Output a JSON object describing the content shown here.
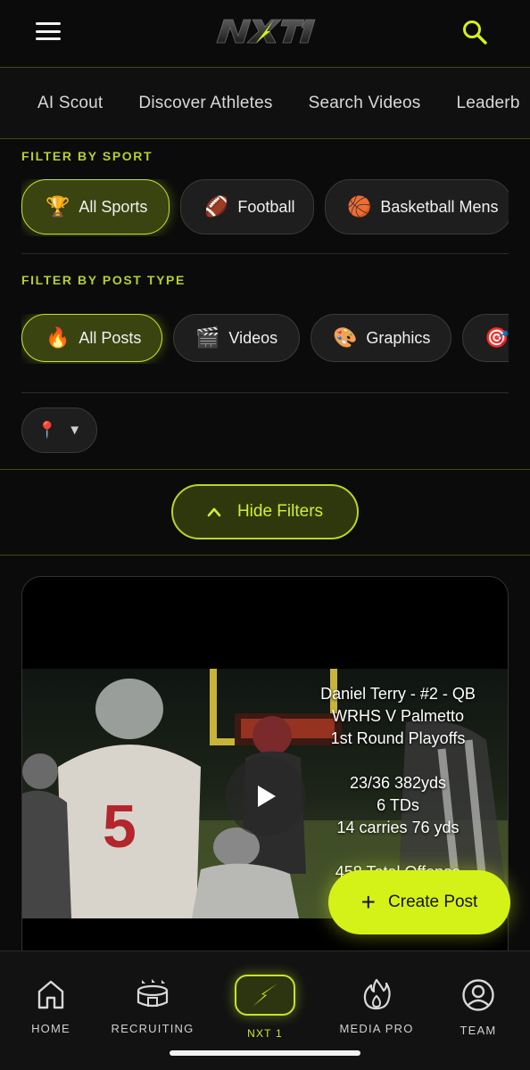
{
  "header": {
    "logo_text": "NXT1",
    "menu_icon": "hamburger-menu-icon",
    "search_icon": "search-icon"
  },
  "tabs": [
    {
      "label": "AI Scout"
    },
    {
      "label": "Discover Athletes"
    },
    {
      "label": "Search Videos"
    },
    {
      "label": "Leaderb"
    }
  ],
  "sport_filter": {
    "label": "FILTER BY SPORT",
    "chips": [
      {
        "label": "All Sports",
        "emoji": "🏆",
        "active": true
      },
      {
        "label": "Football",
        "emoji": "🏈",
        "active": false
      },
      {
        "label": "Basketball Mens",
        "emoji": "🏀",
        "active": false
      }
    ]
  },
  "post_type_filter": {
    "label": "FILTER BY POST TYPE",
    "chips": [
      {
        "label": "All Posts",
        "emoji": "🔥",
        "active": true
      },
      {
        "label": "Videos",
        "emoji": "🎬",
        "active": false
      },
      {
        "label": "Graphics",
        "emoji": "🎨",
        "active": false
      },
      {
        "label": "",
        "emoji": "🎯",
        "active": false
      }
    ]
  },
  "location": {
    "emoji": "📍",
    "caret": "▼"
  },
  "hide_filters": {
    "label": "Hide Filters"
  },
  "post": {
    "overlay_lines": [
      "Daniel Terry - #2 - QB",
      "WRHS V Palmetto",
      "1st Round Playoffs",
      "",
      "23/36 382yds",
      "6 TDs",
      "14 carries 76 yds",
      "",
      "458 Total Offense"
    ]
  },
  "create_post": {
    "label": "Create Post",
    "icon": "+"
  },
  "bottom_nav": {
    "home": "HOME",
    "recruiting": "RECRUITING",
    "nxt1": "NXT 1",
    "media_pro": "MEDIA PRO",
    "team": "TEAM"
  },
  "colors": {
    "accent": "#d4f218",
    "accent_dim": "#b5cf2f",
    "background": "#0b0b0b"
  }
}
